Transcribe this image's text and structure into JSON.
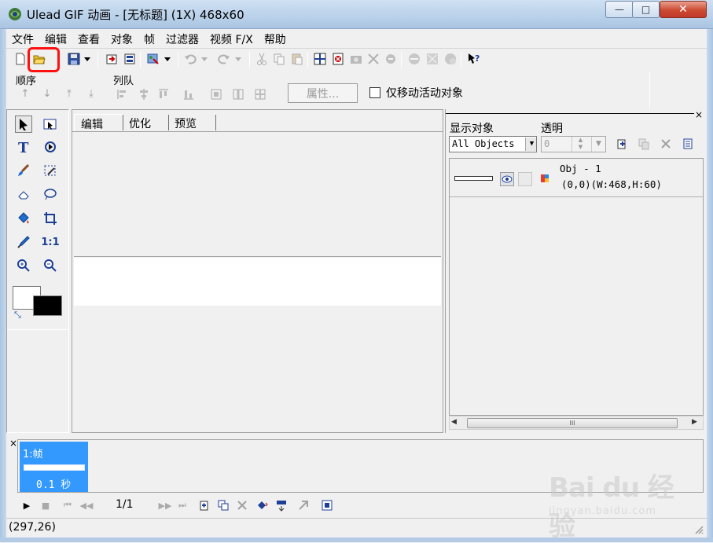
{
  "window": {
    "title": "Ulead GIF 动画 - [无标题] (1X) 468x60",
    "minimize": "—",
    "maximize": "□",
    "close": "✕"
  },
  "menu": [
    "文件",
    "编辑",
    "查看",
    "对象",
    "帧",
    "过滤器",
    "视频 F/X",
    "帮助"
  ],
  "toolbar_icons": [
    "new-file-icon",
    "open-file-icon",
    "save-icon",
    "save-dropdown-icon",
    "import-icon",
    "export-icon",
    "optimize-icon",
    "undo-icon",
    "redo-icon",
    "cut-icon",
    "copy-icon",
    "paste-icon",
    "help-pointer-icon"
  ],
  "propbar": {
    "order_label": "顺序",
    "align_label": "列队",
    "properties_button": "属性...",
    "move_active_label": "仅移动活动对象",
    "move_active_checked": false
  },
  "tabs": [
    {
      "label": "编辑",
      "active": true
    },
    {
      "label": "优化",
      "active": false
    },
    {
      "label": "预览",
      "active": false
    }
  ],
  "object_panel": {
    "show_objects_label": "显示对象",
    "transparency_label": "透明",
    "objects_select_value": "All Objects",
    "transparency_value": "0",
    "objects": [
      {
        "name": "Obj - 1",
        "geometry": "(0,0)(W:468,H:60)"
      }
    ],
    "scroll_grip": "III"
  },
  "frames": [
    {
      "label": "1:帧",
      "delay": "0.1 秒"
    }
  ],
  "playback": {
    "counter": "1/1"
  },
  "status": {
    "coords": "(297,26)"
  },
  "watermark": {
    "logo": "Bai du 经验",
    "url": "jingyan.baidu.com"
  },
  "colors": {
    "foreground": "#ffffff",
    "background": "#000000",
    "highlight": "#ff1010",
    "selected_frame": "#3399ff"
  }
}
